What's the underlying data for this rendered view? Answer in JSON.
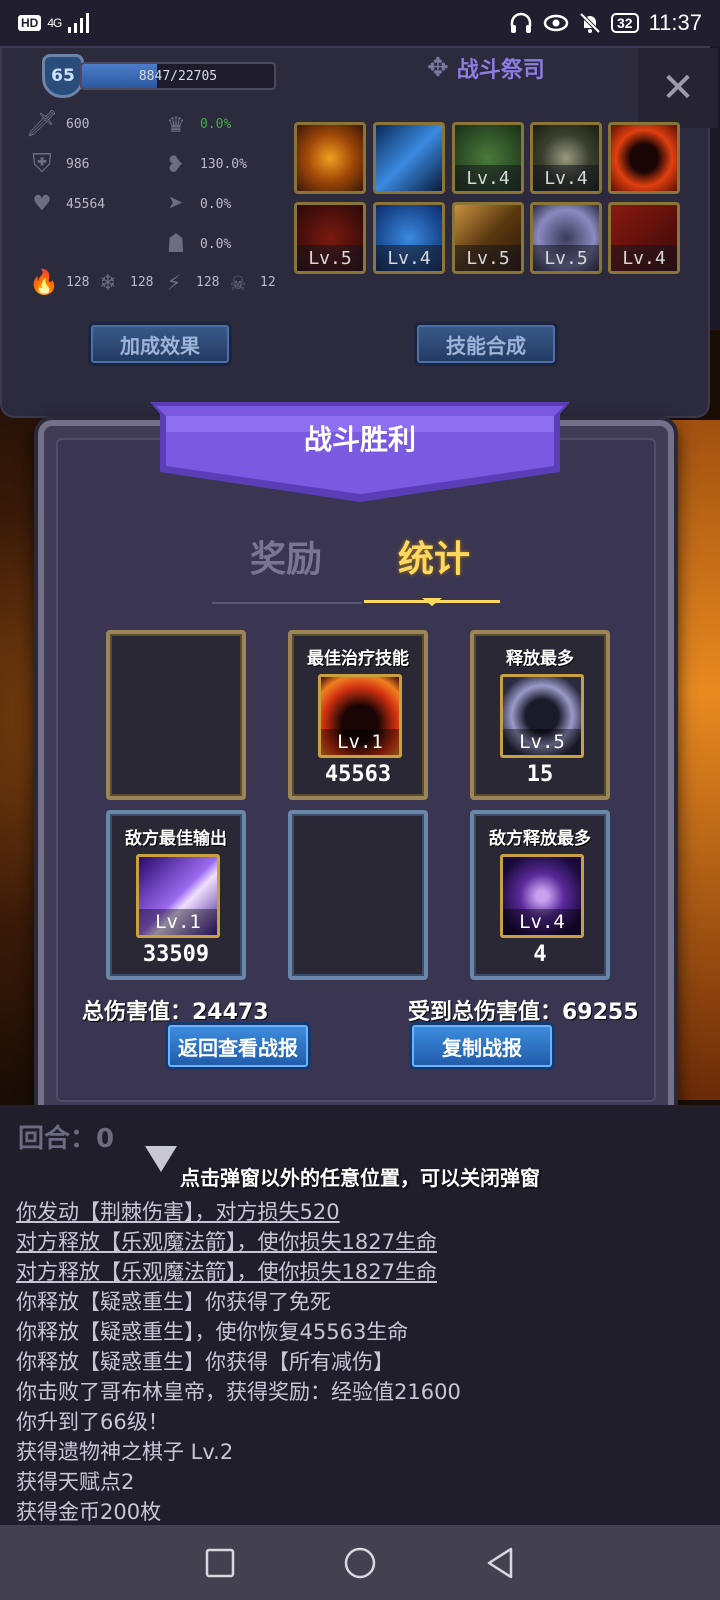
{
  "status_bar": {
    "hd": "HD",
    "network": "4G",
    "battery": "32",
    "time": "11:37"
  },
  "top_panel": {
    "level": "65",
    "xp_text": "8847/22705",
    "xp_progress": 0.39,
    "altar_title": "战斗祭司",
    "stats": {
      "attack": "600",
      "defense": "986",
      "hp": "45564",
      "stat_a": "0.0%",
      "stat_b": "130.0%",
      "stat_c": "0.0%",
      "stat_d": "0.0%",
      "fire": "128",
      "ice": "128",
      "lightning": "128",
      "poison": "12"
    },
    "skills_row1": [
      "",
      "",
      "Lv.4",
      "Lv.4",
      ""
    ],
    "skills_row2": [
      "Lv.5",
      "Lv.4",
      "Lv.5",
      "Lv.5",
      "Lv.4"
    ],
    "bonus_button": "加成效果",
    "combine_button": "技能合成"
  },
  "modal": {
    "title": "战斗胜利",
    "tab_rewards": "奖励",
    "tab_stats": "统计",
    "best_heal_label": "最佳治疗技能",
    "best_heal_lv": "Lv.1",
    "best_heal_value": "45563",
    "most_cast_label": "释放最多",
    "most_cast_lv": "Lv.5",
    "most_cast_value": "15",
    "enemy_best_label": "敌方最佳输出",
    "enemy_best_lv": "Lv.1",
    "enemy_best_value": "33509",
    "enemy_most_label": "敌方释放最多",
    "enemy_most_lv": "Lv.4",
    "enemy_most_value": "4",
    "total_damage": "总伤害值：24473",
    "total_received": "受到总伤害值：69255",
    "btn_view_report": "返回查看战报",
    "btn_copy_report": "复制战报"
  },
  "log": {
    "round_label": "回合：0",
    "hint": "点击弹窗以外的任意位置，可以关闭弹窗",
    "lines": [
      "你发动【荆棘伤害】，对方损失520",
      "对方释放【乐观魔法箭】，使你损失1827生命",
      "对方释放【乐观魔法箭】，使你损失1827生命",
      "你释放【疑惑重生】你获得了免死",
      "你释放【疑惑重生】，使你恢复45563生命",
      "你释放【疑惑重生】你获得【所有减伤】",
      "你击败了哥布林皇帝，获得奖励：经验值21600",
      "你升到了66级！",
      "获得遗物神之棋子 Lv.2",
      "获得天赋点2",
      "获得金币200枚"
    ]
  },
  "colors": {
    "accent_gold": "#ffd860",
    "banner_purple": "#7a5ae0",
    "button_blue": "#2f74c8"
  }
}
